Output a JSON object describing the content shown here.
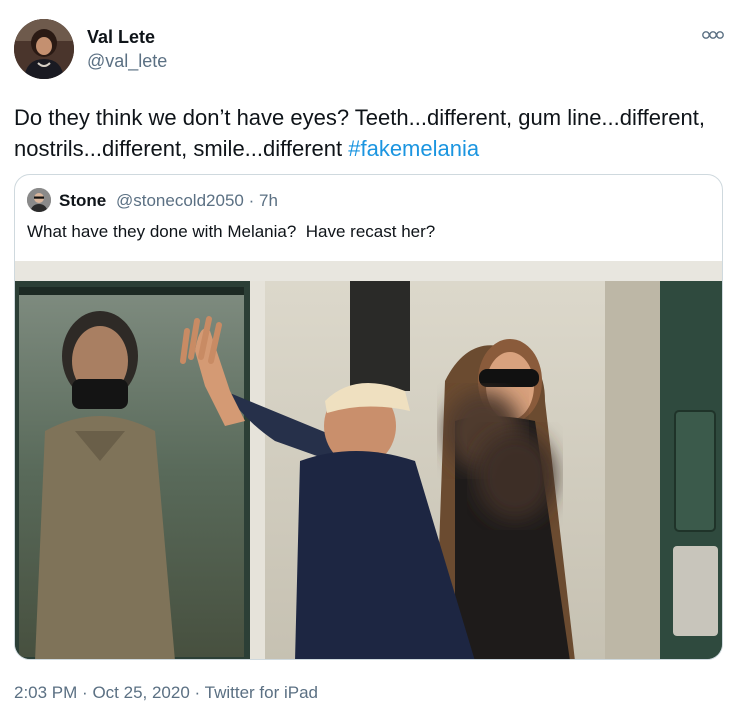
{
  "tweet": {
    "author_name": "Val Lete",
    "author_handle": "@val_lete",
    "text_main": "Do they think we don’t have eyes? Teeth...different, gum line...different, nostrils...different, smile...different ",
    "hashtag": "#fakemelania",
    "more_icon": "more-options-icon"
  },
  "quoted_tweet": {
    "author_name": "Stone",
    "author_handle": "@stonecold2050",
    "separator": "·",
    "time_ago": "7h",
    "text": "What have they done with Melania?  Have recast her?"
  },
  "footer": {
    "time": "2:03 PM",
    "sep1": "·",
    "date": "Oct 25, 2020",
    "sep2": "·",
    "source": "Twitter for iPad"
  },
  "colors": {
    "link": "#1b95e0",
    "secondary_text": "#5b7083",
    "border": "#cfd9de"
  }
}
